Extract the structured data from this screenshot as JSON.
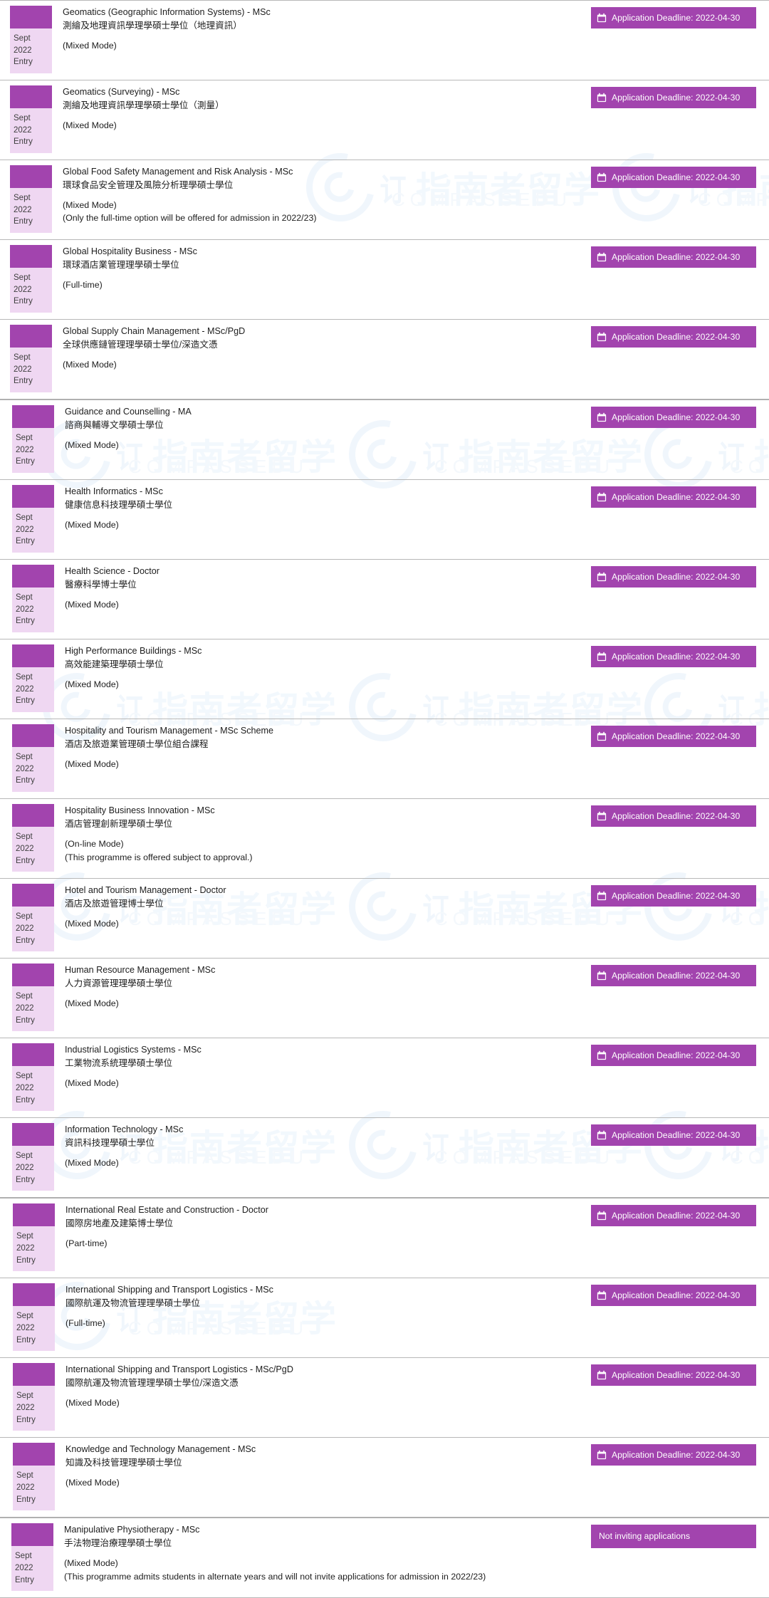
{
  "page": {
    "entry_label_line1": "Sept 2022",
    "entry_label_line2": "Entry",
    "deadline_badge_label": "Application Deadline: 2022-04-30",
    "not_inviting_label": "Not inviting applications",
    "accent_color": "#a244ae",
    "chip_body_color": "#efd7f2",
    "watermark_cn": "指南者留学",
    "watermark_en": "COMPASSEDU",
    "watermark_mark": "订"
  },
  "programmes": [
    {
      "title_en": "Geomatics (Geographic Information Systems) - MSc",
      "title_zh": "測繪及地理資訊學理學碩士學位（地理資訊）",
      "modes": [
        "(Mixed Mode)"
      ],
      "notes": [],
      "badge_type": "deadline",
      "badge_text": "Application Deadline: 2022-04-30",
      "entry": {
        "line1": "Sept 2022",
        "line2": "Entry"
      }
    },
    {
      "title_en": "Geomatics (Surveying) - MSc",
      "title_zh": "測繪及地理資訊學理學碩士學位（測量）",
      "modes": [
        "(Mixed Mode)"
      ],
      "notes": [],
      "badge_type": "deadline",
      "badge_text": "Application Deadline: 2022-04-30",
      "entry": {
        "line1": "Sept 2022",
        "line2": "Entry"
      }
    },
    {
      "title_en": "Global Food Safety Management and Risk Analysis - MSc",
      "title_zh": "環球食品安全管理及風險分析理學碩士學位",
      "modes": [
        "(Mixed Mode)"
      ],
      "notes": [
        "(Only the full-time option will be offered for admission in 2022/23)"
      ],
      "badge_type": "deadline",
      "badge_text": "Application Deadline: 2022-04-30",
      "entry": {
        "line1": "Sept 2022",
        "line2": "Entry"
      }
    },
    {
      "title_en": "Global Hospitality Business - MSc",
      "title_zh": "環球酒店業管理理學碩士學位",
      "modes": [
        "(Full-time)"
      ],
      "notes": [],
      "badge_type": "deadline",
      "badge_text": "Application Deadline: 2022-04-30",
      "entry": {
        "line1": "Sept 2022",
        "line2": "Entry"
      }
    },
    {
      "title_en": "Global Supply Chain Management - MSc/PgD",
      "title_zh": "全球供應鏈管理理學碩士學位/深造文憑",
      "modes": [
        "(Mixed Mode)"
      ],
      "notes": [],
      "badge_type": "deadline",
      "badge_text": "Application Deadline: 2022-04-30",
      "entry": {
        "line1": "Sept 2022",
        "line2": "Entry"
      }
    },
    {
      "title_en": "Guidance and Counselling - MA",
      "title_zh": "諮商與輔導文學碩士學位",
      "modes": [
        "(Mixed Mode)"
      ],
      "notes": [],
      "badge_type": "deadline",
      "badge_text": "Application Deadline: 2022-04-30",
      "entry": {
        "line1": "Sept 2022",
        "line2": "Entry"
      }
    },
    {
      "title_en": "Health Informatics - MSc",
      "title_zh": "健康信息科技理學碩士學位",
      "modes": [
        "(Mixed Mode)"
      ],
      "notes": [],
      "badge_type": "deadline",
      "badge_text": "Application Deadline: 2022-04-30",
      "entry": {
        "line1": "Sept 2022",
        "line2": "Entry"
      }
    },
    {
      "title_en": "Health Science - Doctor",
      "title_zh": "醫療科學博士學位",
      "modes": [
        "(Mixed Mode)"
      ],
      "notes": [],
      "badge_type": "deadline",
      "badge_text": "Application Deadline: 2022-04-30",
      "entry": {
        "line1": "Sept 2022",
        "line2": "Entry"
      }
    },
    {
      "title_en": "High Performance Buildings - MSc",
      "title_zh": "高效能建築理學碩士學位",
      "modes": [
        "(Mixed Mode)"
      ],
      "notes": [],
      "badge_type": "deadline",
      "badge_text": "Application Deadline: 2022-04-30",
      "entry": {
        "line1": "Sept 2022",
        "line2": "Entry"
      }
    },
    {
      "title_en": "Hospitality and Tourism Management - MSc Scheme",
      "title_zh": "酒店及旅遊業管理碩士學位組合課程",
      "modes": [
        "(Mixed Mode)"
      ],
      "notes": [],
      "badge_type": "deadline",
      "badge_text": "Application Deadline: 2022-04-30",
      "entry": {
        "line1": "Sept 2022",
        "line2": "Entry"
      }
    },
    {
      "title_en": "Hospitality Business Innovation - MSc",
      "title_zh": "酒店管理創新理學碩士學位",
      "modes": [
        "(On-line Mode)"
      ],
      "notes": [
        "(This programme is offered subject to approval.)"
      ],
      "badge_type": "deadline",
      "badge_text": "Application Deadline: 2022-04-30",
      "entry": {
        "line1": "Sept 2022",
        "line2": "Entry"
      }
    },
    {
      "title_en": "Hotel and Tourism Management - Doctor",
      "title_zh": "酒店及旅遊管理博士學位",
      "modes": [
        "(Mixed Mode)"
      ],
      "notes": [],
      "badge_type": "deadline",
      "badge_text": "Application Deadline: 2022-04-30",
      "entry": {
        "line1": "Sept 2022",
        "line2": "Entry"
      }
    },
    {
      "title_en": "Human Resource Management - MSc",
      "title_zh": "人力資源管理理學碩士學位",
      "modes": [
        "(Mixed Mode)"
      ],
      "notes": [],
      "badge_type": "deadline",
      "badge_text": "Application Deadline: 2022-04-30",
      "entry": {
        "line1": "Sept 2022",
        "line2": "Entry"
      }
    },
    {
      "title_en": "Industrial Logistics Systems - MSc",
      "title_zh": "工業物流系統理學碩士學位",
      "modes": [
        "(Mixed Mode)"
      ],
      "notes": [],
      "badge_type": "deadline",
      "badge_text": "Application Deadline: 2022-04-30",
      "entry": {
        "line1": "Sept 2022",
        "line2": "Entry"
      }
    },
    {
      "title_en": "Information Technology - MSc",
      "title_zh": "資訊科技理學碩士學位",
      "modes": [
        "(Mixed Mode)"
      ],
      "notes": [],
      "badge_type": "deadline",
      "badge_text": "Application Deadline: 2022-04-30",
      "entry": {
        "line1": "Sept 2022",
        "line2": "Entry"
      }
    },
    {
      "title_en": "International Real Estate and Construction - Doctor",
      "title_zh": "國際房地產及建築博士學位",
      "modes": [
        "(Part-time)"
      ],
      "notes": [],
      "badge_type": "deadline",
      "badge_text": "Application Deadline: 2022-04-30",
      "entry": {
        "line1": "Sept 2022",
        "line2": "Entry"
      }
    },
    {
      "title_en": "International Shipping and Transport Logistics - MSc",
      "title_zh": "國際航運及物流管理理學碩士學位",
      "modes": [
        "(Full-time)"
      ],
      "notes": [],
      "badge_type": "deadline",
      "badge_text": "Application Deadline: 2022-04-30",
      "entry": {
        "line1": "Sept 2022",
        "line2": "Entry"
      }
    },
    {
      "title_en": "International Shipping and Transport Logistics - MSc/PgD",
      "title_zh": "國際航運及物流管理理學碩士學位/深造文憑",
      "modes": [
        "(Mixed Mode)"
      ],
      "notes": [],
      "badge_type": "deadline",
      "badge_text": "Application Deadline: 2022-04-30",
      "entry": {
        "line1": "Sept 2022",
        "line2": "Entry"
      }
    },
    {
      "title_en": "Knowledge and Technology Management - MSc",
      "title_zh": "知識及科技管理理學碩士學位",
      "modes": [
        "(Mixed Mode)"
      ],
      "notes": [],
      "badge_type": "deadline",
      "badge_text": "Application Deadline: 2022-04-30",
      "entry": {
        "line1": "Sept 2022",
        "line2": "Entry"
      }
    },
    {
      "title_en": "Manipulative Physiotherapy - MSc",
      "title_zh": "手法物理治療理學碩士學位",
      "modes": [
        "(Mixed Mode)"
      ],
      "notes": [
        "(This programme admits students in alternate years and will not invite applications for admission in 2022/23)"
      ],
      "badge_type": "notice",
      "badge_text": "Not inviting applications",
      "entry": {
        "line1": "Sept 2022",
        "line2": "Entry"
      }
    }
  ]
}
